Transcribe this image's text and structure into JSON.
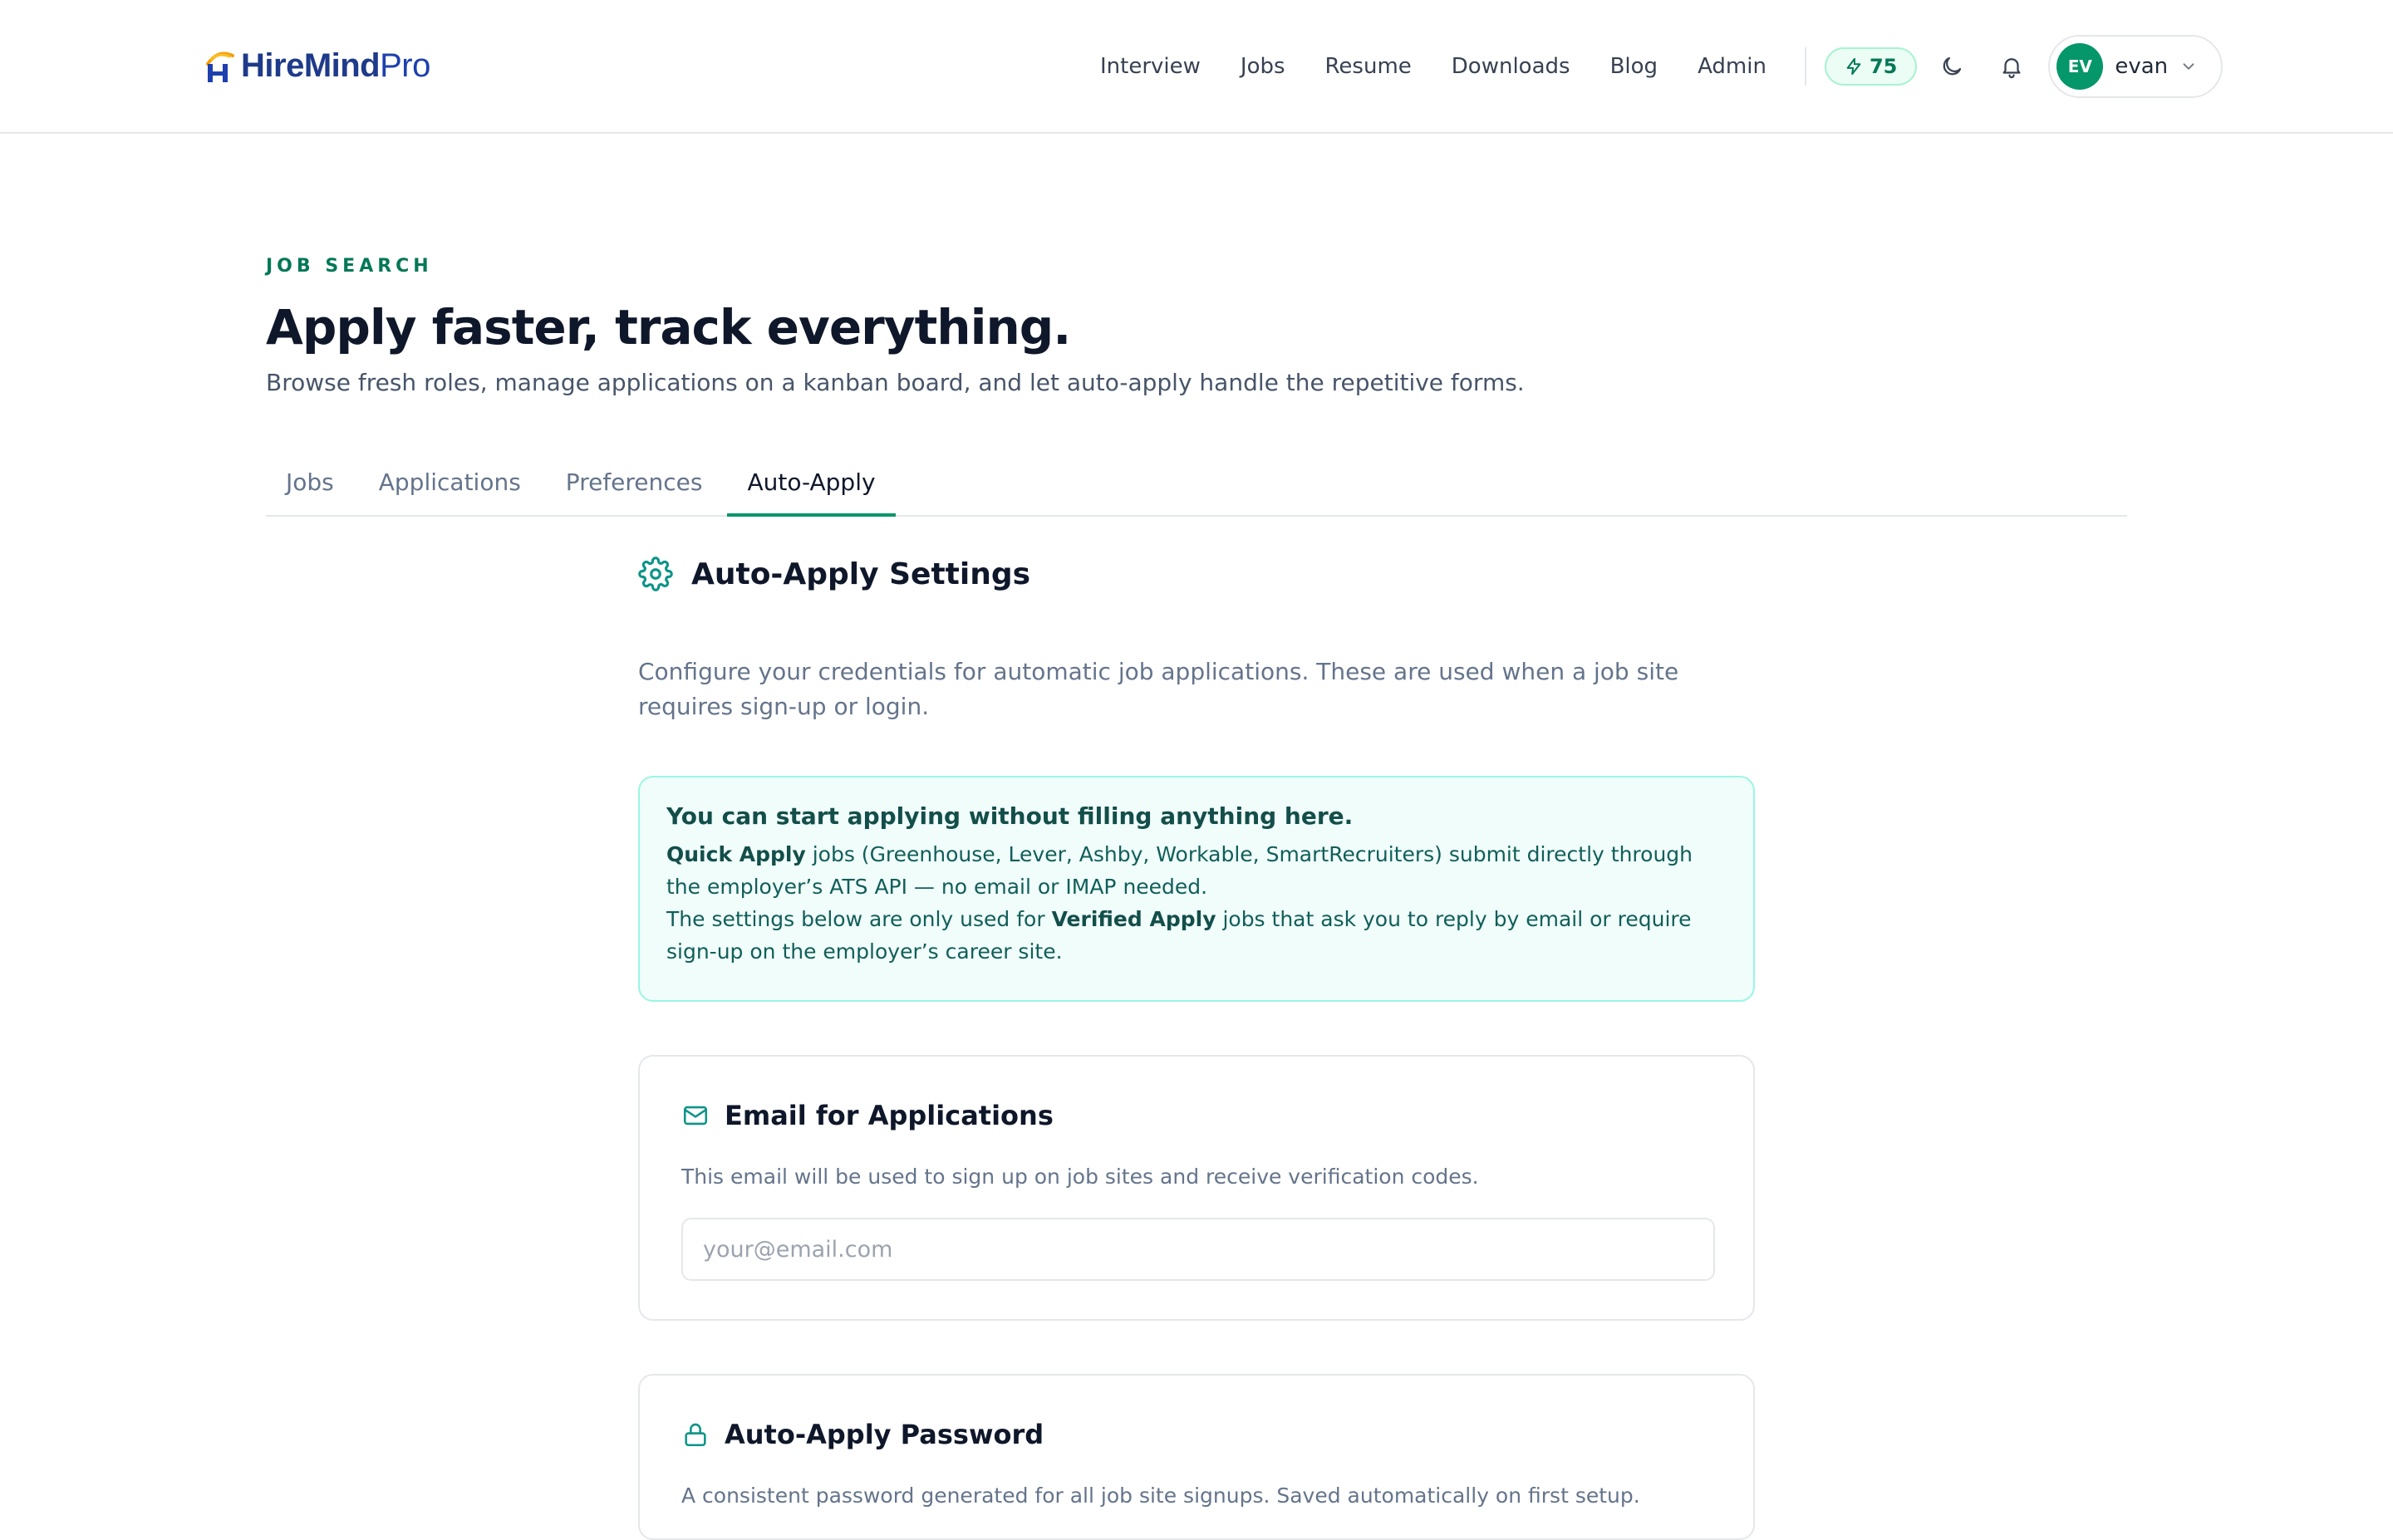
{
  "brand": {
    "name_main": "HireMind",
    "name_suffix": "Pro"
  },
  "nav": {
    "links": [
      "Interview",
      "Jobs",
      "Resume",
      "Downloads",
      "Blog",
      "Admin"
    ],
    "credits": "75",
    "user": {
      "initials": "EV",
      "name": "evan"
    }
  },
  "hero": {
    "eyebrow": "JOB SEARCH",
    "title": "Apply faster, track everything.",
    "subtitle": "Browse fresh roles, manage applications on a kanban board, and let auto-apply handle the repetitive forms."
  },
  "tabs": [
    {
      "label": "Jobs",
      "active": false
    },
    {
      "label": "Applications",
      "active": false
    },
    {
      "label": "Preferences",
      "active": false
    },
    {
      "label": "Auto-Apply",
      "active": true
    }
  ],
  "settings": {
    "title": "Auto-Apply Settings",
    "description": "Configure your credentials for automatic job applications. These are used when a job site requires sign-up or login.",
    "info": {
      "title": "You can start applying without filling anything here.",
      "line1_bold": "Quick Apply",
      "line1_rest": " jobs (Greenhouse, Lever, Ashby, Workable, SmartRecruiters) submit directly through the employer’s ATS API — no email or IMAP needed.",
      "line2_pre": "The settings below are only used for ",
      "line2_bold": "Verified Apply",
      "line2_rest": " jobs that ask you to reply by email or require sign-up on the employer’s career site."
    },
    "email_card": {
      "title": "Email for Applications",
      "description": "This email will be used to sign up on job sites and receive verification codes.",
      "placeholder": "your@email.com",
      "value": ""
    },
    "password_card": {
      "title": "Auto-Apply Password",
      "description": "A consistent password generated for all job site signups. Saved automatically on first setup."
    }
  },
  "colors": {
    "accent": "#059669",
    "brand": "#1e3a8a",
    "logo_accent": "#f59e0b",
    "info_bg": "#f0fdfa"
  },
  "icons": {
    "credits": "lightning-icon",
    "theme": "moon-icon",
    "notifications": "bell-icon",
    "user_menu": "chevron-down-icon",
    "settings": "gear-icon",
    "email": "mail-icon",
    "password": "lock-icon"
  }
}
